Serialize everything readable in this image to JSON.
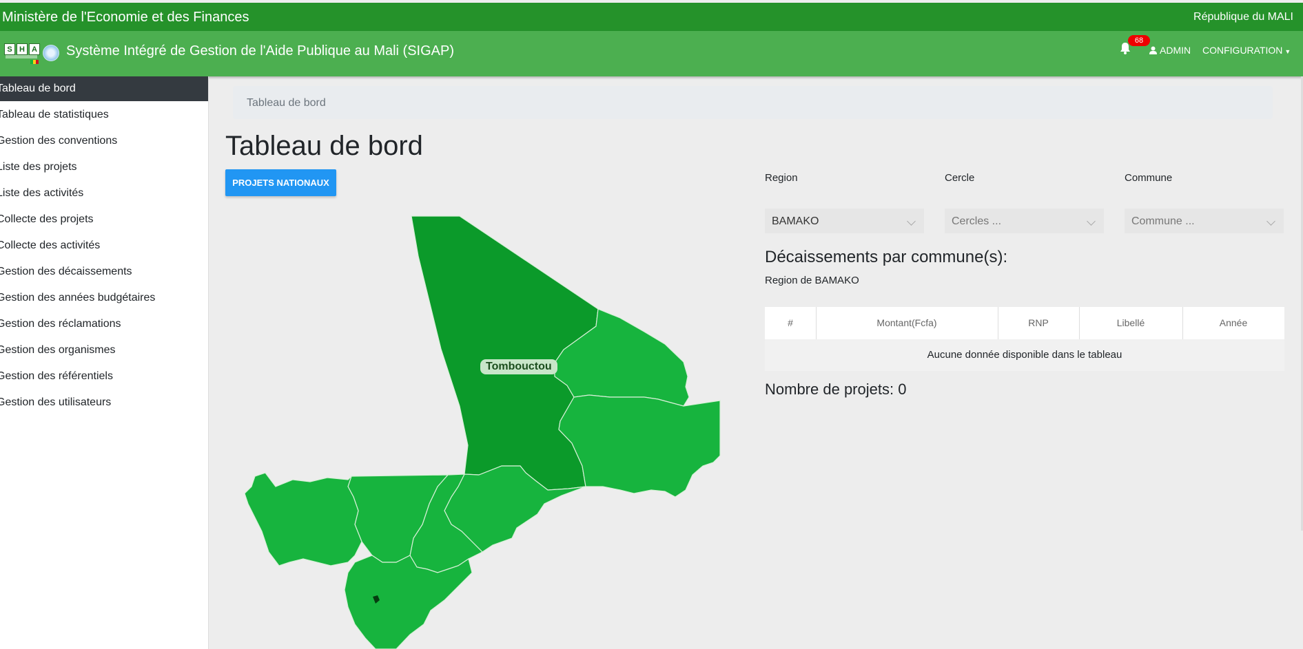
{
  "topbar": {
    "ministry": "Ministère de l'Economie et des Finances",
    "republic": "République du MALI"
  },
  "navbar": {
    "logo_text": [
      "S",
      "H",
      "A"
    ],
    "app_title": "Système Intégré de Gestion de l'Aide Publique au Mali (SIGAP)",
    "notifications_count": "68",
    "admin_label": "ADMIN",
    "config_label": "CONFIGURATION"
  },
  "sidebar": {
    "items": [
      {
        "label": "Tableau de bord",
        "active": true
      },
      {
        "label": "Tableau de statistiques"
      },
      {
        "label": "Gestion des conventions"
      },
      {
        "label": "Liste des projets"
      },
      {
        "label": "Liste des activités"
      },
      {
        "label": "Collecte des projets"
      },
      {
        "label": "Collecte des activités"
      },
      {
        "label": "Gestion des décaissements"
      },
      {
        "label": "Gestion des années budgétaires"
      },
      {
        "label": "Gestion des réclamations"
      },
      {
        "label": "Gestion des organismes"
      },
      {
        "label": "Gestion des référentiels"
      },
      {
        "label": "Gestion des utilisateurs"
      }
    ]
  },
  "main": {
    "breadcrumb": "Tableau de bord",
    "title": "Tableau de bord",
    "projets_button": "PROJETS NATIONAUX",
    "map_label": "Tombouctou",
    "filters": {
      "region_label": "Region",
      "cercle_label": "Cercle",
      "commune_label": "Commune",
      "region_value": "BAMAKO",
      "cercle_placeholder": "Cercles ...",
      "commune_placeholder": "Commune ..."
    },
    "section_title": "Décaissements par commune(s):",
    "region_line": "Region de BAMAKO",
    "table": {
      "columns": [
        "#",
        "Montant(Fcfa)",
        "RNP",
        "Libellé",
        "Année"
      ],
      "empty_message": "Aucune donnée disponible dans le tableau"
    },
    "projects_count": "Nombre de projets: 0"
  },
  "colors": {
    "topbar": "#25922a",
    "navbar": "#4caf50",
    "map_dark": "#0b9a2a",
    "map_light": "#17b43e",
    "button": "#2196f3",
    "badge": "#e00000"
  }
}
